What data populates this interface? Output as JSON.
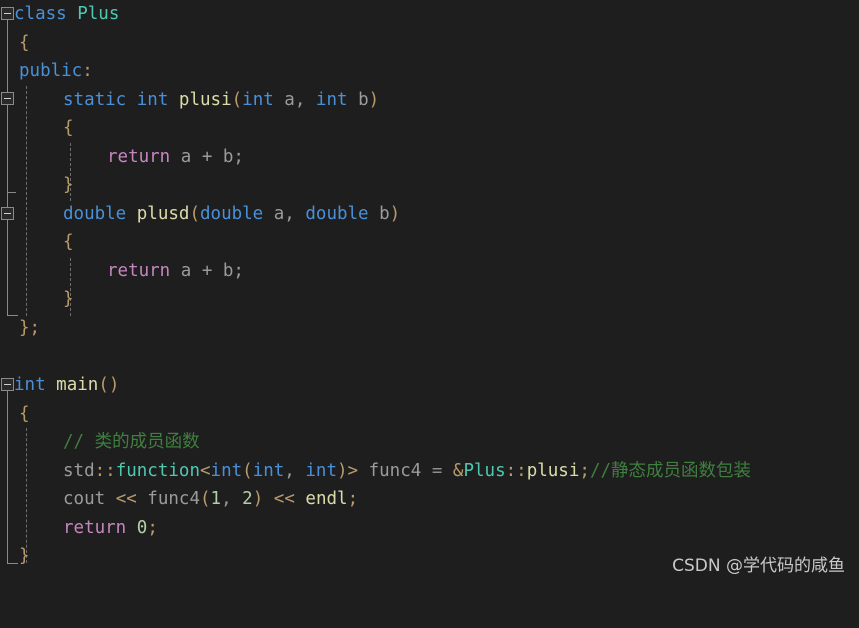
{
  "editor": {
    "background_color": "#1e1e1e",
    "language": "C++",
    "font_size_px": 17.5,
    "line_height_px": 28.5
  },
  "colors": {
    "keyword": "#4a90d9",
    "type": "#4ec9b0",
    "function": "#dcdcaa",
    "return_keyword": "#c586c0",
    "number": "#b5cea8",
    "comment": "#3f7f3f",
    "punctuation": "#b99b6b",
    "identifier": "#9b9b9b",
    "gutter": "#8a8a8a",
    "watermark": "#d8d8d8"
  },
  "code": {
    "lines": [
      {
        "indent": 0,
        "text": "class Plus"
      },
      {
        "indent": 1,
        "text": "{"
      },
      {
        "indent": 1,
        "text": "public:"
      },
      {
        "indent": 2,
        "text": "static int plusi(int a, int b)"
      },
      {
        "indent": 2,
        "text": "{"
      },
      {
        "indent": 3,
        "text": "return a + b;"
      },
      {
        "indent": 2,
        "text": "}"
      },
      {
        "indent": 2,
        "text": "double plusd(double a, double b)"
      },
      {
        "indent": 2,
        "text": "{"
      },
      {
        "indent": 3,
        "text": "return a + b;"
      },
      {
        "indent": 2,
        "text": "}"
      },
      {
        "indent": 1,
        "text": "};"
      },
      {
        "indent": 0,
        "text": ""
      },
      {
        "indent": 0,
        "text": "int main()"
      },
      {
        "indent": 1,
        "text": "{"
      },
      {
        "indent": 2,
        "text": "// 类的成员函数"
      },
      {
        "indent": 2,
        "text": "std::function<int(int, int)> func4 = &Plus::plusi;//静态成员函数包装"
      },
      {
        "indent": 2,
        "text": "cout << func4(1, 2) << endl;"
      },
      {
        "indent": 2,
        "text": "return 0;"
      },
      {
        "indent": 1,
        "text": "}"
      }
    ],
    "line_1": {
      "kw": "class",
      "type": "Plus"
    },
    "line_2": {
      "brace": "{"
    },
    "line_3": {
      "kw": "public",
      "punct": ":"
    },
    "line_4": {
      "kw1": "static",
      "kw2": "int",
      "fn": "plusi",
      "p1": "(",
      "t1": "int",
      "a": " a, ",
      "t2": "int",
      "b": " b",
      "p2": ")"
    },
    "line_5": {
      "brace": "{"
    },
    "line_6": {
      "ret": "return",
      "expr": " a + b;"
    },
    "line_7": {
      "brace": "}"
    },
    "line_8": {
      "kw1": "double",
      "fn": "plusd",
      "p1": "(",
      "t1": "double",
      "a": " a, ",
      "t2": "double",
      "b": " b",
      "p2": ")"
    },
    "line_9": {
      "brace": "{"
    },
    "line_10": {
      "ret": "return",
      "expr": " a + b;"
    },
    "line_11": {
      "brace": "}"
    },
    "line_12": {
      "brace": "}",
      "semi": ";"
    },
    "line_14": {
      "kw": "int",
      "fn": "main",
      "parens": "()"
    },
    "line_15": {
      "brace": "{"
    },
    "line_16": {
      "comment": "// 类的成员函数"
    },
    "line_17": {
      "std": "std",
      "scope1": "::",
      "function": "function",
      "lt": "<",
      "int1": "int",
      "open": "(",
      "int2": "int",
      "comma": ", ",
      "int3": "int",
      "close": ")",
      "gt": ">",
      "var": " func4 ",
      "eq": "=",
      "amp": " &",
      "cls": "Plus",
      "scope2": "::",
      "member": "plusi",
      "semi": ";",
      "comment": "//静态成员函数包装"
    },
    "line_18": {
      "cout": "cout ",
      "shift1": "<<",
      "call": " func4",
      "open": "(",
      "n1": "1",
      "comma": ", ",
      "n2": "2",
      "close": ")",
      "shift2": " << ",
      "endl": "endl",
      "semi": ";"
    },
    "line_19": {
      "ret": "return",
      "space": " ",
      "num": "0",
      "semi": ";"
    },
    "line_20": {
      "brace": "}"
    }
  },
  "watermark": {
    "text": "CSDN @学代码的咸鱼"
  }
}
